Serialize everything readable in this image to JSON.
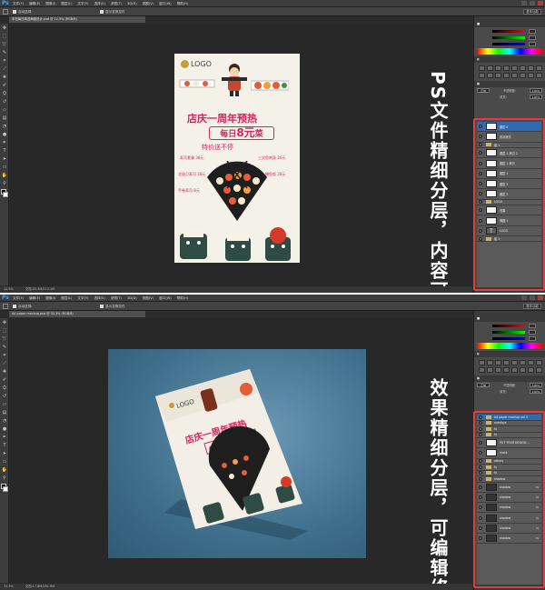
{
  "screens": {
    "top": {
      "menu": [
        "文件(F)",
        "编辑(E)",
        "图像(I)",
        "图层(L)",
        "文字(Y)",
        "选择(S)",
        "滤镜(T)",
        "3D(D)",
        "视图(V)",
        "窗口(W)",
        "帮助(H)"
      ],
      "options": {
        "auto_select": "自动选择:",
        "show_transform": "显示变换控件",
        "workspace": "基本功能"
      },
      "doc_tab": "本日每日精选海报设计.psd @ 12.5% (RGB/8)",
      "status_zoom": "12.5%",
      "status_doc": "文档:33.3M/213.1M",
      "layer_controls": {
        "mode": "正常",
        "opacity_label": "不透明度:",
        "opacity": "100%",
        "fill_label": "填充:",
        "fill": "100%"
      },
      "layers": [
        {
          "name": "图层 8",
          "kind": "layer"
        },
        {
          "name": "形状拷贝",
          "kind": "layer"
        },
        {
          "name": "组 1",
          "kind": "folder"
        },
        {
          "name": "图层 1 拷贝 2",
          "kind": "layer"
        },
        {
          "name": "图层 1 拷贝",
          "kind": "layer"
        },
        {
          "name": "图层 1",
          "kind": "layer"
        },
        {
          "name": "图层 3",
          "kind": "layer"
        },
        {
          "name": "图层 2",
          "kind": "layer"
        },
        {
          "name": "LOGO",
          "kind": "folder"
        },
        {
          "name": "效果",
          "kind": "layer"
        },
        {
          "name": "椭圆 1",
          "kind": "layer"
        },
        {
          "name": "LOGO",
          "kind": "text"
        },
        {
          "name": "组 1",
          "kind": "folder"
        }
      ],
      "overlay_text": "PS文件精细分层，内容可修改"
    },
    "bottom": {
      "menu": [
        "文件(F)",
        "编辑(E)",
        "图像(I)",
        "图层(L)",
        "文字(Y)",
        "选择(S)",
        "滤镜(T)",
        "3D(D)",
        "视图(V)",
        "窗口(W)",
        "帮助(H)"
      ],
      "options": {
        "auto_select": "自动选择:",
        "show_transform": "显示变换控件",
        "workspace": "基本功能"
      },
      "doc_tab": "A4 paper mockup.psd @ 33.3% (RGB/8)",
      "status_zoom": "33.3%",
      "status_doc": "文档:17.8M/181.9M",
      "layer_controls": {
        "mode": "正常",
        "opacity_label": "不透明度:",
        "opacity": "100%",
        "fill_label": "填充:",
        "fill": "100%"
      },
      "layers": [
        {
          "name": "A4 paper mockup vol 3",
          "kind": "folder"
        },
        {
          "name": "overlays",
          "kind": "folder"
        },
        {
          "name": "fx",
          "kind": "layer"
        },
        {
          "name": "fx",
          "kind": "layer"
        },
        {
          "name": "PUT YOUR DESIGN ...",
          "kind": "smart"
        },
        {
          "name": "mask",
          "kind": "layer"
        },
        {
          "name": "others",
          "kind": "folder"
        },
        {
          "name": "fx",
          "kind": "layer"
        },
        {
          "name": "fx",
          "kind": "layer"
        },
        {
          "name": "shadow",
          "kind": "folder"
        },
        {
          "name": "shadow",
          "kind": "layer"
        },
        {
          "name": "shadow",
          "kind": "layer"
        },
        {
          "name": "shadow",
          "kind": "layer"
        },
        {
          "name": "shadow",
          "kind": "layer"
        },
        {
          "name": "shadow",
          "kind": "layer"
        },
        {
          "name": "shadow",
          "kind": "layer"
        }
      ],
      "overlay_text": "效果精细分层，可编辑修改"
    }
  },
  "poster": {
    "logo": "LOGO",
    "title1": "店庆一周年预热",
    "title2_pre": "每日",
    "title2_big": "8元",
    "title2_post": "菜",
    "title3": "特价送不停",
    "tags": [
      "寿司套餐 38元",
      "三文鱼刺身 26元",
      "北极贝寿司 18元",
      "鳗鱼饭 28元",
      "手卷寿司 8元"
    ]
  },
  "colors": {
    "accent_red": "#e53b3b",
    "poster_pink": "#d6245e",
    "ps_blue": "#3ea6ff",
    "selected_layer": "#2f6bb5"
  }
}
